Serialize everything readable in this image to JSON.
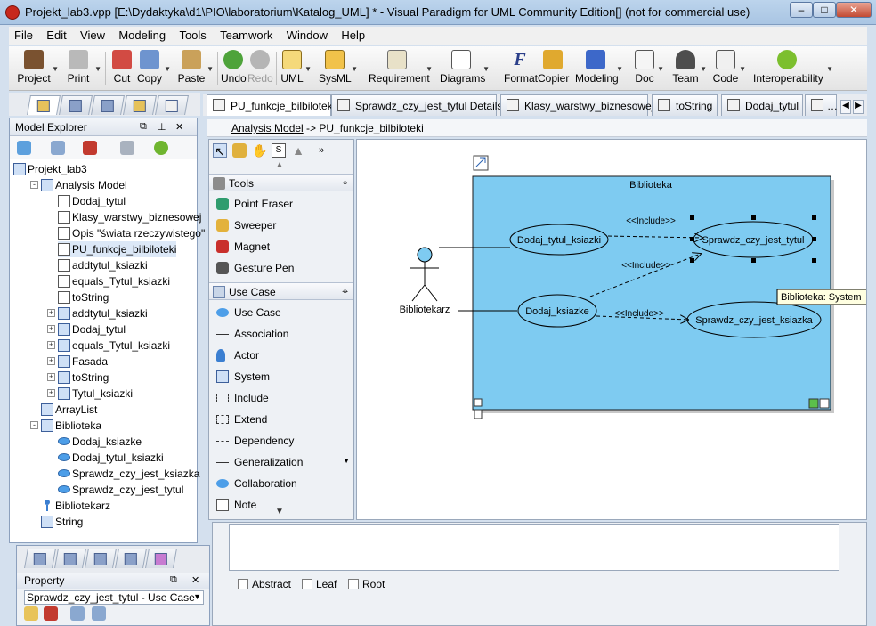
{
  "window": {
    "title": "Projekt_lab3.vpp [E:\\Dydaktyka\\d1\\PIO\\laboratorium\\Katalog_UML] * - Visual Paradigm for UML Community Edition[] (not for commercial use)",
    "minimize": "–",
    "maximize": "□",
    "close": "✕"
  },
  "menu": [
    "File",
    "Edit",
    "View",
    "Modeling",
    "Tools",
    "Teamwork",
    "Window",
    "Help"
  ],
  "toolbar": {
    "project": "Project",
    "print": "Print",
    "cut": "Cut",
    "copy": "Copy",
    "paste": "Paste",
    "undo": "Undo",
    "redo": "Redo",
    "uml": "UML",
    "sysml": "SysML",
    "requirement": "Requirement",
    "diagrams": "Diagrams",
    "format": "Format",
    "copier": "Copier",
    "modeling": "Modeling",
    "doc": "Doc",
    "team": "Team",
    "code": "Code",
    "interoperability": "Interoperability"
  },
  "tabs": [
    "PU_funkcje_bilbiloteki",
    "Sprawdz_czy_jest_tytul Details",
    "Klasy_warstwy_biznesowej",
    "toString",
    "Dodaj_tytul"
  ],
  "explorer": {
    "title": "Model Explorer",
    "items": [
      "Projekt_lab3",
      "Analysis Model",
      "Dodaj_tytul",
      "Klasy_warstwy_biznesowej",
      "Opis \"świata rzeczywistego\"",
      "PU_funkcje_bilbiloteki",
      "addtytul_ksiazki",
      "equals_Tytul_ksiazki",
      "toString",
      "addtytul_ksiazki",
      "Dodaj_tytul",
      "equals_Tytul_ksiazki",
      "Fasada",
      "toString",
      "Tytul_ksiazki",
      "ArrayList",
      "Biblioteka",
      "Dodaj_ksiazke",
      "Dodaj_tytul_ksiazki",
      "Sprawdz_czy_jest_ksiazka",
      "Sprawdz_czy_jest_tytul",
      "Bibliotekarz",
      "String"
    ]
  },
  "property": {
    "title": "Property",
    "selected": "Sprawdz_czy_jest_tytul - Use Case"
  },
  "breadcrumb": {
    "model": "Analysis Model",
    "diagram": " -> PU_funkcje_bilbiloteki"
  },
  "palette": {
    "tools_header": "Tools",
    "tools": [
      "Point Eraser",
      "Sweeper",
      "Magnet",
      "Gesture Pen"
    ],
    "usecase_header": "Use Case",
    "usecase": [
      "Use Case",
      "Association",
      "Actor",
      "System",
      "Include",
      "Extend",
      "Dependency",
      "Generalization",
      "Collaboration",
      "Note"
    ]
  },
  "diagram": {
    "system": "Biblioteka",
    "actor": "Bibliotekarz",
    "uc1": "Dodaj_tytul_ksiazki",
    "uc2": "Sprawdz_czy_jest_tytul",
    "uc3": "Dodaj_ksiazke",
    "uc4": "Sprawdz_czy_jest_ksiazka",
    "include1": "<<Include>>",
    "include2": "<<Include>>",
    "include3": "<<Include>>",
    "tooltip": "Biblioteka: System"
  },
  "options": {
    "abstract": "Abstract",
    "leaf": "Leaf",
    "root": "Root"
  },
  "colors": {
    "system_fill": "#7ecbf1",
    "usecase_fill": "#7ecbf1",
    "accent": "#3b7fd1"
  }
}
